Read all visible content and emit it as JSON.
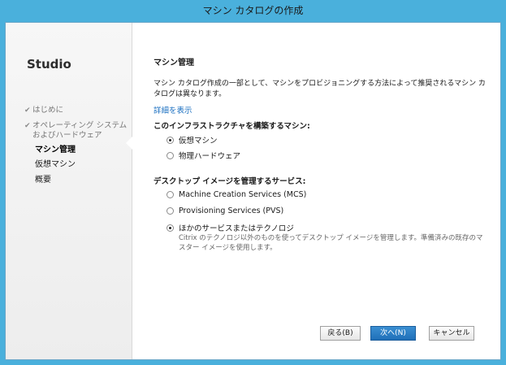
{
  "window": {
    "title": "マシン カタログの作成"
  },
  "sidebar": {
    "brand": "Studio",
    "items": [
      {
        "label": "はじめに",
        "state": "done"
      },
      {
        "label": "オペレーティング システム",
        "label2": "およびハードウェア",
        "state": "done"
      },
      {
        "label": "マシン管理",
        "state": "current"
      },
      {
        "label": "仮想マシン",
        "state": "pending"
      },
      {
        "label": "概要",
        "state": "pending"
      }
    ]
  },
  "main": {
    "heading": "マシン管理",
    "description": "マシン カタログ作成の一部として、マシンをプロビジョニングする方法によって推奨されるマシン カタログは異なります。",
    "details_link": "詳細を表示",
    "infra_heading": "このインフラストラクチャを構築するマシン:",
    "infra_options": [
      {
        "label": "仮想マシン",
        "selected": true
      },
      {
        "label": "物理ハードウェア",
        "selected": false
      }
    ],
    "service_heading": "デスクトップ イメージを管理するサービス:",
    "service_options": [
      {
        "label": "Machine Creation Services (MCS)",
        "selected": false
      },
      {
        "label": "Provisioning Services (PVS)",
        "selected": false
      },
      {
        "label": "ほかのサービスまたはテクノロジ",
        "selected": true,
        "sub": "Citrix のテクノロジ以外のものを使ってデスクトップ イメージを管理します。準備済みの既存のマスター イメージを使用します。"
      }
    ]
  },
  "buttons": {
    "back": "戻る(B)",
    "next": "次へ(N)",
    "cancel": "キャンセル"
  },
  "colors": {
    "accent": "#1f6fb8",
    "frame": "#4ab0dc",
    "link": "#1a6fc0"
  }
}
